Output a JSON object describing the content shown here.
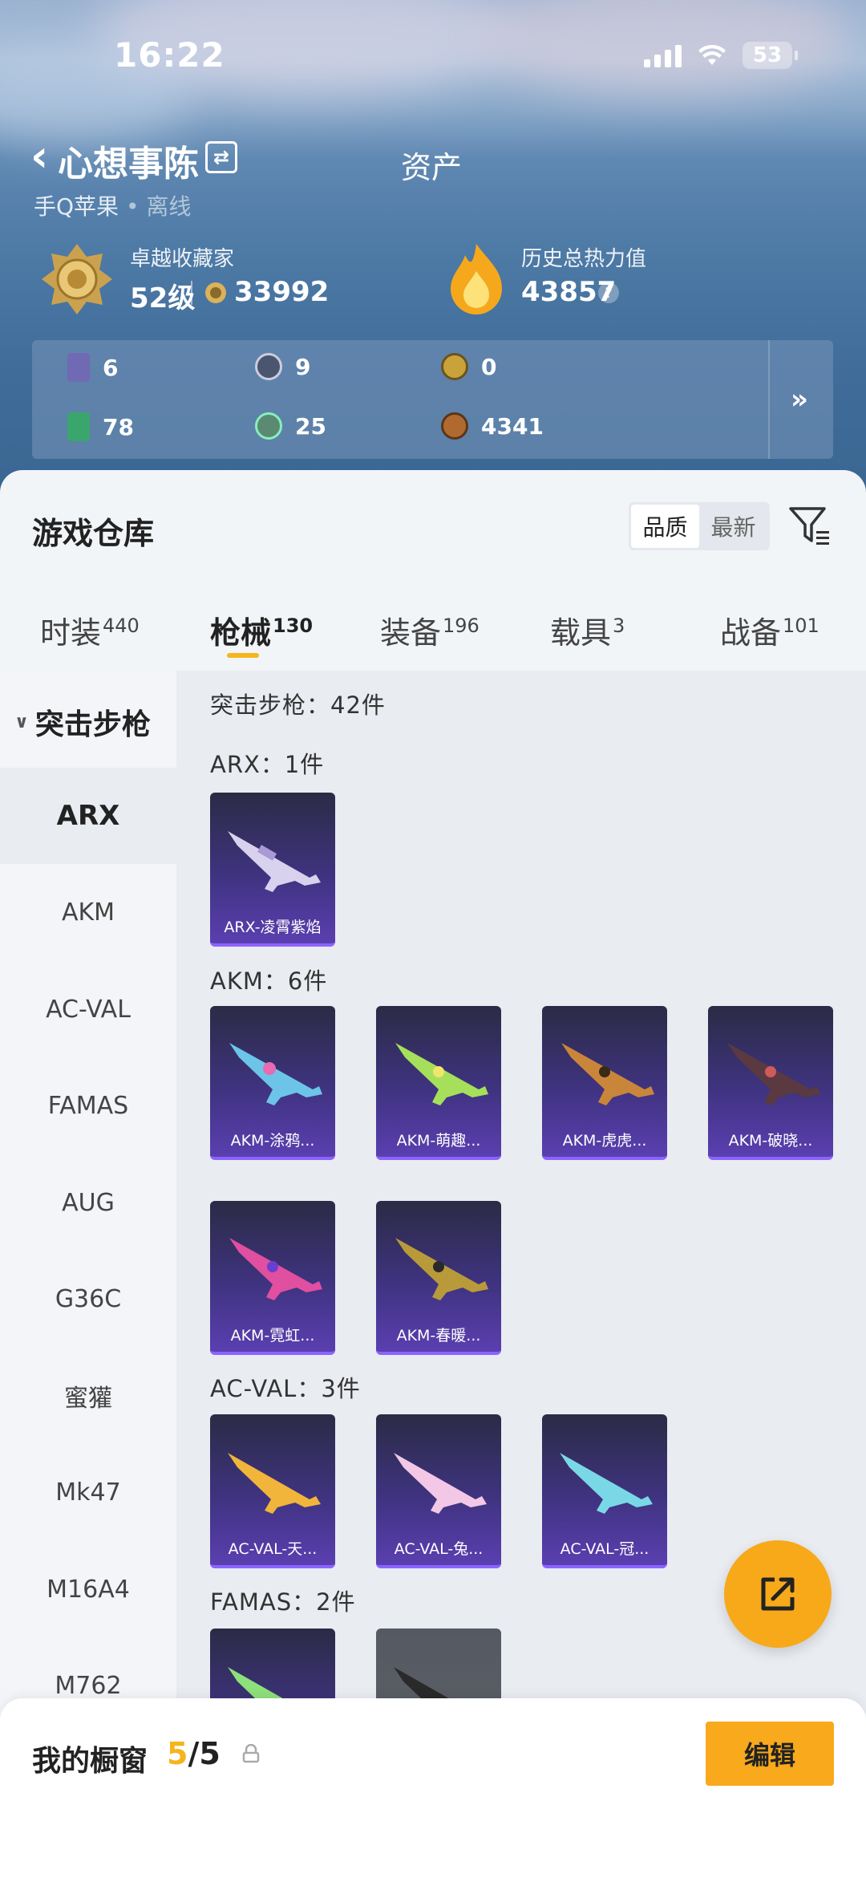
{
  "status_bar": {
    "time": "16:22",
    "battery": "53"
  },
  "header": {
    "player_name": "心想事陈",
    "title": "资产",
    "platform": "手Q苹果",
    "presence": "离线"
  },
  "stats": {
    "collector_title": "卓越收藏家",
    "level": "52级",
    "points": "33992",
    "heat_label": "历史总热力值",
    "heat_value": "43857",
    "help": "?"
  },
  "resources": [
    {
      "icon": "card-icon",
      "value": "6",
      "color": "#6f6ab3"
    },
    {
      "icon": "coin-s-icon",
      "value": "9",
      "color": "#4a5570"
    },
    {
      "icon": "coin-a-icon",
      "value": "0",
      "color": "#c9a23a"
    },
    {
      "icon": "ticket-icon",
      "value": "78",
      "color": "#3aa56c"
    },
    {
      "icon": "orb-icon",
      "value": "25",
      "color": "#5a8a72"
    },
    {
      "icon": "bronze-coin-icon",
      "value": "4341",
      "color": "#b06a30"
    }
  ],
  "warehouse": {
    "title": "游戏仓库",
    "sort": [
      "品质",
      "最新"
    ]
  },
  "tabs": [
    {
      "label": "时装",
      "count": "440"
    },
    {
      "label": "枪械",
      "count": "130"
    },
    {
      "label": "装备",
      "count": "196"
    },
    {
      "label": "载具",
      "count": "3"
    },
    {
      "label": "战备",
      "count": "101"
    }
  ],
  "sidebar": {
    "category": "突击步枪",
    "items": [
      "ARX",
      "AKM",
      "AC-VAL",
      "FAMAS",
      "AUG",
      "G36C",
      "蜜獾",
      "Mk47",
      "M16A4",
      "M762"
    ]
  },
  "category_count": "突击步枪：42件",
  "sections": [
    {
      "header": "ARX：1件",
      "items": [
        "ARX-凌霄紫焰"
      ]
    },
    {
      "header": "AKM：6件",
      "items": [
        "AKM-涂鸦...",
        "AKM-萌趣...",
        "AKM-虎虎...",
        "AKM-破晓...",
        "AKM-霓虹...",
        "AKM-春暖..."
      ]
    },
    {
      "header": "AC-VAL：3件",
      "items": [
        "AC-VAL-天...",
        "AC-VAL-兔...",
        "AC-VAL-冠..."
      ]
    },
    {
      "header": "FAMAS：2件",
      "items": [
        "",
        ""
      ]
    }
  ],
  "bottom": {
    "label": "我的橱窗",
    "count_used": "5",
    "count_total": "/5",
    "edit": "编辑"
  },
  "colors": {
    "accent": "#f5b51c",
    "fab": "#f7a91a",
    "card_purple": "#5a3fb0"
  }
}
